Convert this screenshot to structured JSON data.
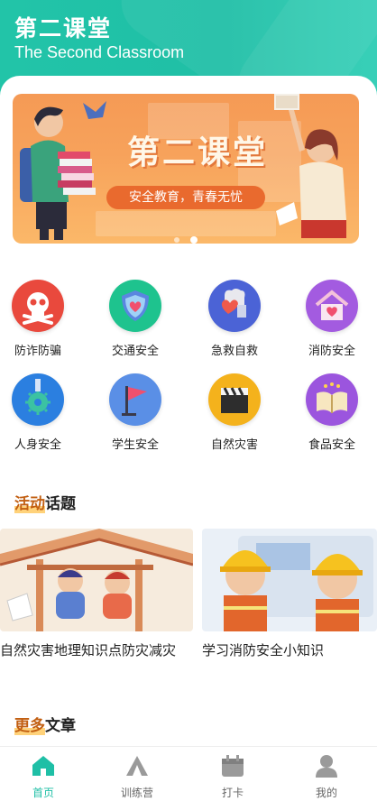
{
  "header": {
    "title_cn": "第二课堂",
    "title_en": "The Second Classroom"
  },
  "banner": {
    "title": "第二课堂",
    "subtitle": "安全教育，青春无忧",
    "slides": 2,
    "active_slide": 2
  },
  "categories": [
    {
      "label": "防诈防骗",
      "icon": "skull-icon",
      "color": "#e9493d"
    },
    {
      "label": "交通安全",
      "icon": "shield-heart-icon",
      "color": "#1ec38e"
    },
    {
      "label": "急救自救",
      "icon": "first-aid-icon",
      "color": "#4b63d6"
    },
    {
      "label": "消防安全",
      "icon": "house-heart-icon",
      "color": "#a35be0"
    },
    {
      "label": "人身安全",
      "icon": "virus-icon",
      "color": "#2b7fe0"
    },
    {
      "label": "学生安全",
      "icon": "flag-icon",
      "color": "#5a8fe6"
    },
    {
      "label": "自然灾害",
      "icon": "clapperboard-icon",
      "color": "#f4b21c"
    },
    {
      "label": "食品安全",
      "icon": "book-icon",
      "color": "#9b55de"
    }
  ],
  "sections": {
    "activities_hl": "活动",
    "activities_rest": "话题",
    "more_hl": "更多",
    "more_rest": "文章"
  },
  "activities": [
    {
      "caption": "自然灾害地理知识点防灾减灾"
    },
    {
      "caption": "学习消防安全小知识"
    }
  ],
  "tabbar": [
    {
      "label": "首页",
      "icon": "home-icon",
      "active": true
    },
    {
      "label": "训练营",
      "icon": "tent-icon",
      "active": false
    },
    {
      "label": "打卡",
      "icon": "calendar-icon",
      "active": false
    },
    {
      "label": "我的",
      "icon": "user-icon",
      "active": false
    }
  ],
  "colors": {
    "brand": "#1fbfa6",
    "banner": "#f7a25b",
    "highlight": "#ffd27a"
  }
}
